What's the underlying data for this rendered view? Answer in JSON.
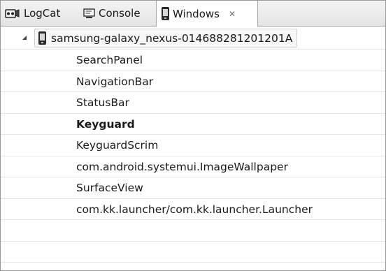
{
  "tabs": {
    "logcat": {
      "label": "LogCat",
      "icon": "logcat-icon"
    },
    "console": {
      "label": "Console",
      "icon": "console-icon"
    },
    "windows": {
      "label": "Windows",
      "icon": "phone-icon",
      "close": "✕"
    }
  },
  "device": {
    "name": "samsung-galaxy_nexus-014688281201201A",
    "expanded": true
  },
  "windows": [
    {
      "name": "SearchPanel",
      "focused": false
    },
    {
      "name": "NavigationBar",
      "focused": false
    },
    {
      "name": "StatusBar",
      "focused": false
    },
    {
      "name": "Keyguard",
      "focused": true
    },
    {
      "name": "KeyguardScrim",
      "focused": false
    },
    {
      "name": "com.android.systemui.ImageWallpaper",
      "focused": false
    },
    {
      "name": "SurfaceView",
      "focused": false
    },
    {
      "name": "com.kk.launcher/com.kk.launcher.Launcher",
      "focused": false
    }
  ],
  "colors": {
    "tabbar_bg": "#e8e8e8",
    "active_tab_bg": "#ffffff",
    "row_divider": "#e6e6e6",
    "text": "#1a1a1a"
  }
}
